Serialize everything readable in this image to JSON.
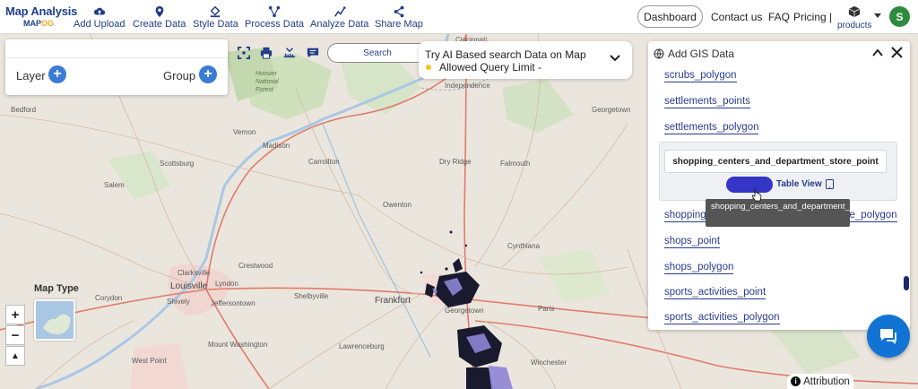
{
  "app": {
    "logo_title": "Map Analysis",
    "logo_sub_a": "MAP",
    "logo_sub_b": "OG"
  },
  "nav": {
    "items": [
      {
        "label": "Add Upload",
        "icon": "cloud-upload-icon"
      },
      {
        "label": "Create Data",
        "icon": "map-pin-icon"
      },
      {
        "label": "Style Data",
        "icon": "paint-bucket-icon"
      },
      {
        "label": "Process Data",
        "icon": "process-icon"
      },
      {
        "label": "Analyze Data",
        "icon": "analyze-icon"
      },
      {
        "label": "Share Map",
        "icon": "share-icon"
      }
    ],
    "dashboard": "Dashboard",
    "contact": "Contact us",
    "faq": "FAQ",
    "pricing": "Pricing |",
    "products": "products",
    "avatar_initial": "S",
    "avatar_color": "#2e8b3d"
  },
  "layer_panel": {
    "layer_label": "Layer",
    "group_label": "Group"
  },
  "toolbar": {
    "search_placeholder": "Search"
  },
  "ai_search": {
    "line1": "Try AI Based search Data on Map",
    "line2": "Allowed Query Limit -"
  },
  "gis_panel": {
    "title": "Add GIS Data",
    "links_top": [
      "scrubs_polygon",
      "settlements_points",
      "settlements_polygon"
    ],
    "card_field": "shopping_centers_and_department_store_point",
    "table_view": "Table View",
    "links_bottom": [
      "shopping_centers_and_department_store_polygon",
      "shops_point",
      "shops_polygon",
      "sports_activities_point",
      "sports_activities_polygon"
    ],
    "tooltip": "shopping_centers_and_department_store_point",
    "accent": "#3535c8"
  },
  "map": {
    "map_type_label": "Map Type",
    "zoom_in": "+",
    "zoom_out": "−",
    "north": "▲",
    "attribution": "Attribution",
    "places": [
      "Cincinnati",
      "Independence",
      "Bedford",
      "Hoosier National Forest",
      "Vernon",
      "Madison",
      "Georgetown",
      "Carrollton",
      "Dry Ridge",
      "Falmouth",
      "Scottsburg",
      "Salem",
      "Owenton",
      "Crestwood",
      "Clarksville",
      "Louisville",
      "Lyndon",
      "Jeffersontown",
      "Shelbyville",
      "Cynthiana",
      "Frankfort",
      "Georgetown",
      "Paris",
      "Corydon",
      "Shively",
      "Lawrenceburg",
      "Mount Washington",
      "West Point",
      "Winchester"
    ]
  }
}
